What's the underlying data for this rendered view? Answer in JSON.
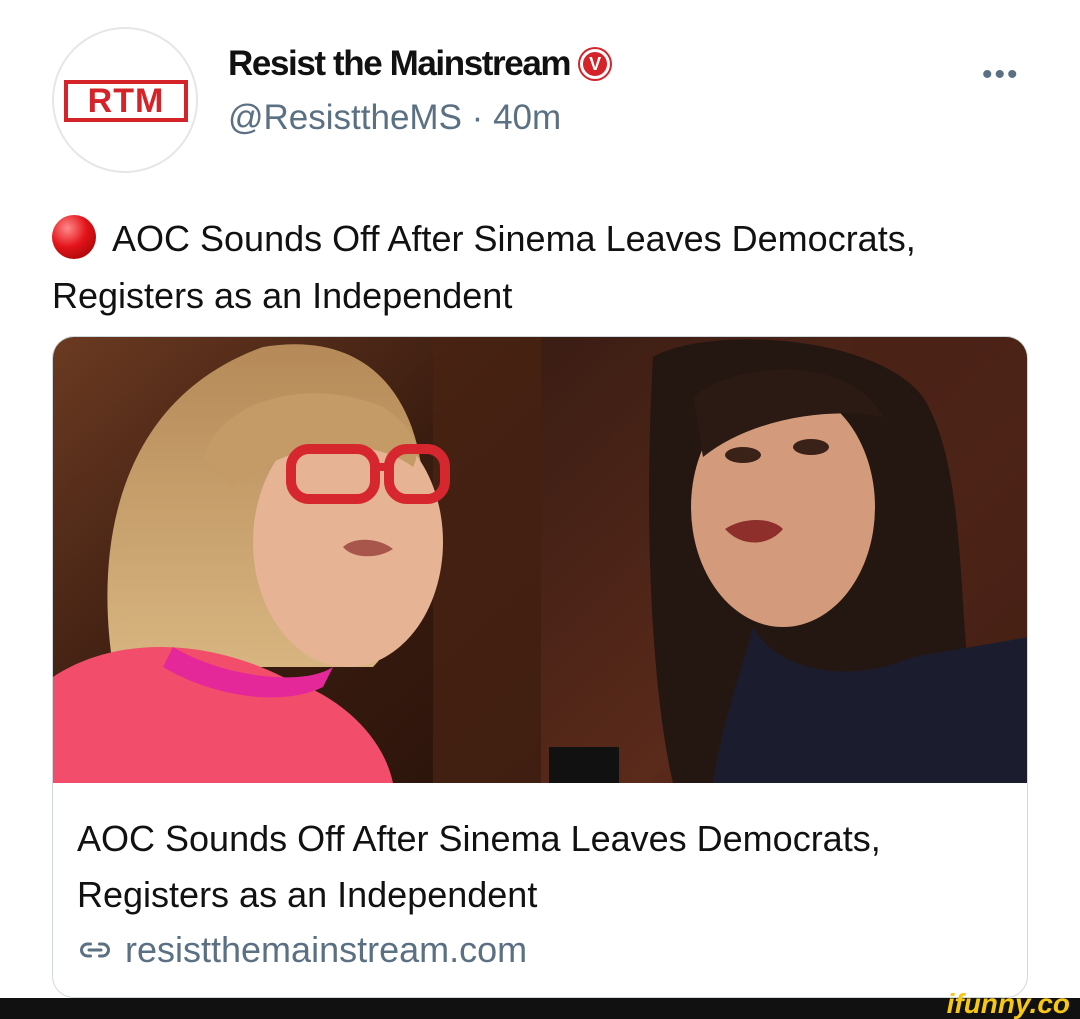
{
  "author": {
    "name": "Resist the Mainstream",
    "avatar_text": "RTM",
    "verified_icon": "V",
    "handle": "@ResisttheMS",
    "separator": "·",
    "time": "40m"
  },
  "more_label": "•••",
  "tweet": {
    "text": "AOC Sounds Off After Sinema Leaves Democrats, Registers as an Independent"
  },
  "card": {
    "title": "AOC Sounds Off After Sinema Leaves Democrats, Registers as an Independent",
    "domain": "resistthemainstream.com"
  },
  "watermark": "ifunny.co",
  "colors": {
    "brand_red": "#d5232a",
    "secondary_text": "#5b7083",
    "card_border": "#cfd9de"
  }
}
